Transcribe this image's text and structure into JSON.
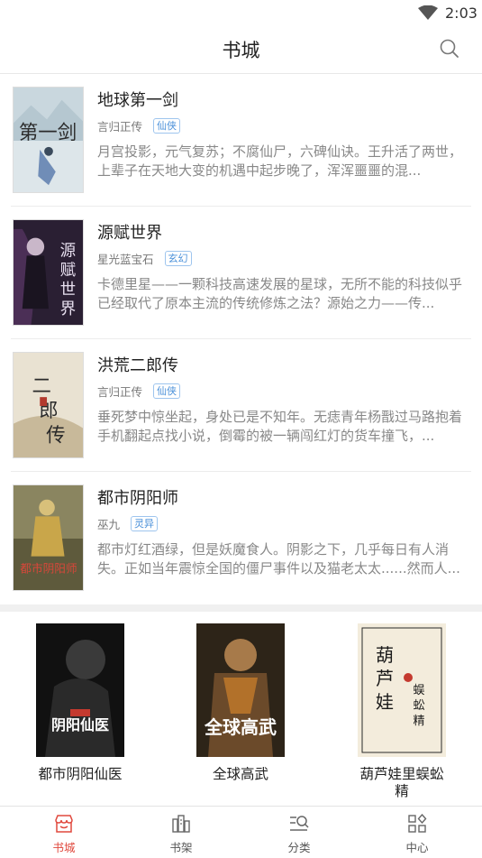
{
  "status_bar": {
    "time": "2:03"
  },
  "header": {
    "title": "书城"
  },
  "books": [
    {
      "title": "地球第一剑",
      "author": "言归正传",
      "tag": "仙侠",
      "description": "月宫投影，元气复苏；不腐仙尸，六碑仙诀。王升活了两世，上辈子在天地大变的机遇中起步晚了，浑浑噩噩的混..."
    },
    {
      "title": "源赋世界",
      "author": "星光蓝宝石",
      "tag": "玄幻",
      "description": "卡德里星——一颗科技高速发展的星球，无所不能的科技似乎已经取代了原本主流的传统修炼之法？源始之力——传..."
    },
    {
      "title": "洪荒二郎传",
      "author": "言归正传",
      "tag": "仙侠",
      "description": "垂死梦中惊坐起，身处已是不知年。无痣青年杨戬过马路抱着手机翻起点找小说，倒霉的被一辆闯红灯的货车撞飞，..."
    },
    {
      "title": "都市阴阳师",
      "author": "巫九",
      "tag": "灵异",
      "description": "都市灯红酒绿，但是妖魔食人。阴影之下，几乎每日有人消失。正如当年震惊全国的僵尸事件以及猫老太太......然而人..."
    }
  ],
  "featured": [
    {
      "title": "都市阴阳仙医"
    },
    {
      "title": "全球高武"
    },
    {
      "title": "葫芦娃里蜈蚣精"
    }
  ],
  "nav": [
    {
      "label": "书城",
      "active": true
    },
    {
      "label": "书架",
      "active": false
    },
    {
      "label": "分类",
      "active": false
    },
    {
      "label": "中心",
      "active": false
    }
  ],
  "colors": {
    "accent": "#e0483d",
    "tag": "#4a90d9",
    "text_secondary": "#888888"
  },
  "icons": {
    "wifi": "wifi-icon",
    "search": "search-icon",
    "nav": [
      "store-icon",
      "bookshelf-icon",
      "category-icon",
      "center-icon"
    ]
  }
}
